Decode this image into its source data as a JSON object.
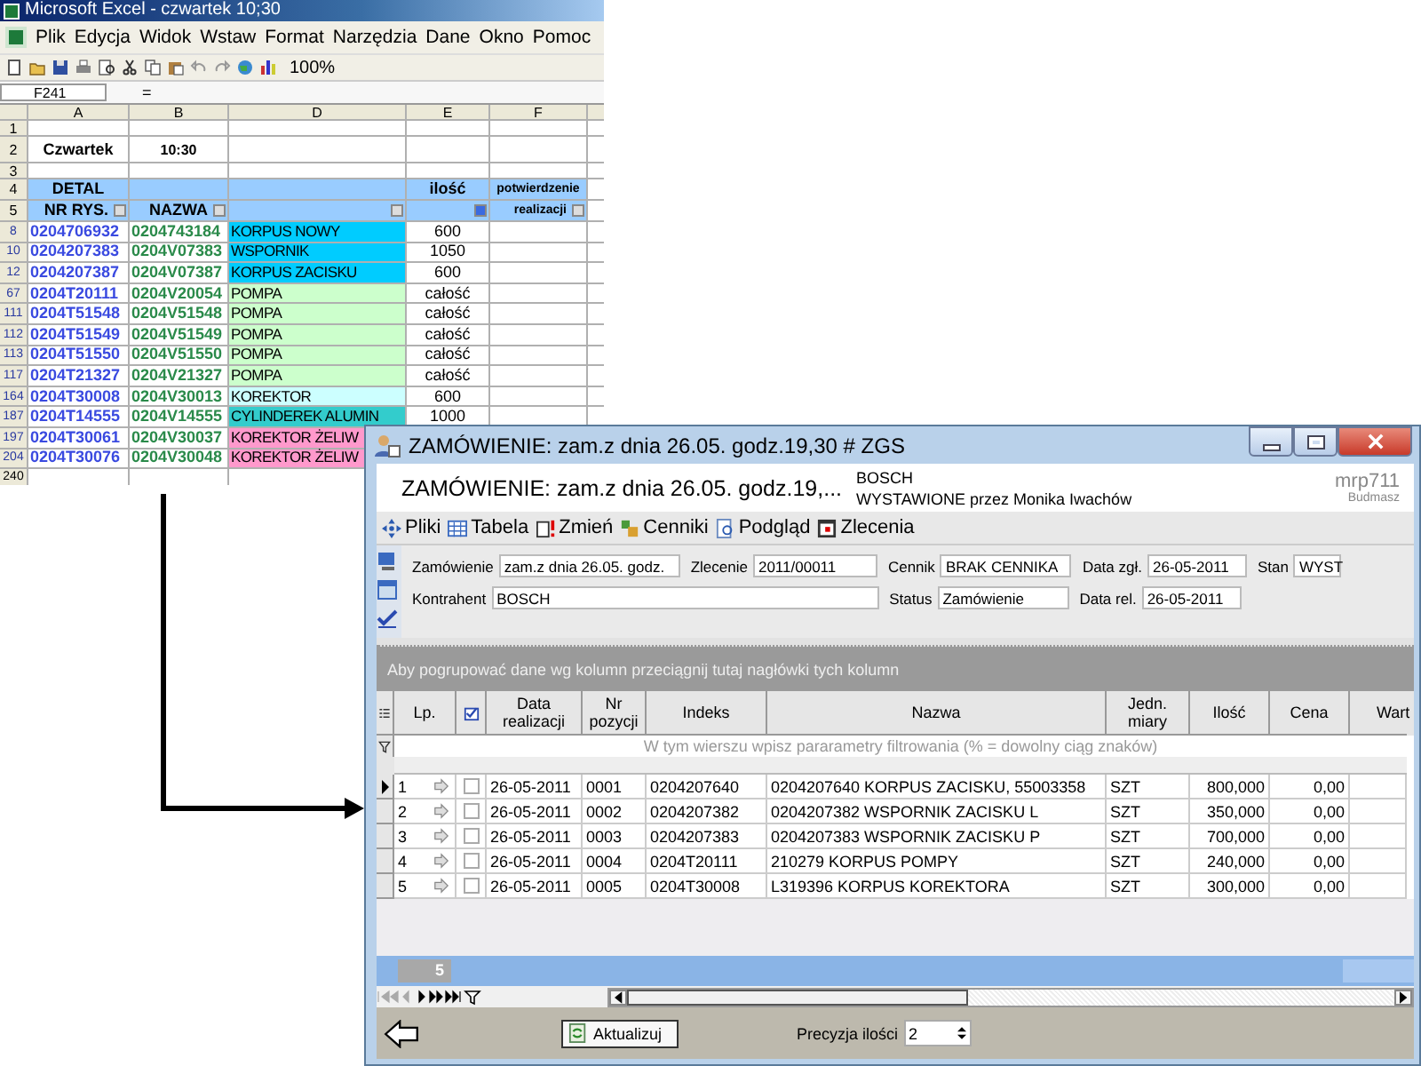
{
  "excel": {
    "title": "Microsoft Excel - czwartek 10;30",
    "menu": [
      "Plik",
      "Edycja",
      "Widok",
      "Wstaw",
      "Format",
      "Narzędzia",
      "Dane",
      "Okno",
      "Pomoc"
    ],
    "zoom": "100%",
    "name_box": "F241",
    "formula_sign": "=",
    "columns": [
      "A",
      "B",
      "D",
      "E",
      "F"
    ],
    "top_rows": [
      "1",
      "2",
      "3",
      "4",
      "5"
    ],
    "day": "Czwartek",
    "time": "10:30",
    "header": {
      "detal": "DETAL",
      "nr_rys": "NR RYS.",
      "nazwa": "NAZWA",
      "ilosc": "ilość",
      "confirm_1": "potwierdzenie",
      "confirm_2": "realizacji"
    },
    "rows": [
      {
        "num": "8",
        "nr_rys": "0204706932",
        "nazwa": "0204743184",
        "opis": "KORPUS NOWY",
        "color": "#00ccff",
        "ilosc": "600"
      },
      {
        "num": "10",
        "nr_rys": "0204207383",
        "nazwa": "0204V07383",
        "opis": "WSPORNIK",
        "color": "#00ccff",
        "ilosc": "1050"
      },
      {
        "num": "12",
        "nr_rys": "0204207387",
        "nazwa": "0204V07387",
        "opis": "KORPUS ZACISKU",
        "color": "#00ccff",
        "ilosc": "600"
      },
      {
        "num": "67",
        "nr_rys": "0204T20111",
        "nazwa": "0204V20054",
        "opis": "POMPA",
        "color": "#ccffcc",
        "ilosc": "całość"
      },
      {
        "num": "111",
        "nr_rys": "0204T51548",
        "nazwa": "0204V51548",
        "opis": "POMPA",
        "color": "#ccffcc",
        "ilosc": "całość"
      },
      {
        "num": "112",
        "nr_rys": "0204T51549",
        "nazwa": "0204V51549",
        "opis": "POMPA",
        "color": "#ccffcc",
        "ilosc": "całość"
      },
      {
        "num": "113",
        "nr_rys": "0204T51550",
        "nazwa": "0204V51550",
        "opis": "POMPA",
        "color": "#ccffcc",
        "ilosc": "całość"
      },
      {
        "num": "117",
        "nr_rys": "0204T21327",
        "nazwa": "0204V21327",
        "opis": "POMPA",
        "color": "#ccffcc",
        "ilosc": "całość"
      },
      {
        "num": "164",
        "nr_rys": "0204T30008",
        "nazwa": "0204V30013",
        "opis": "KOREKTOR",
        "color": "#ccffff",
        "ilosc": "600"
      },
      {
        "num": "187",
        "nr_rys": "0204T14555",
        "nazwa": "0204V14555",
        "opis": "CYLINDEREK ALUMIN",
        "color": "#33cccc",
        "ilosc": "1000"
      },
      {
        "num": "197",
        "nr_rys": "0204T30061",
        "nazwa": "0204V30037",
        "opis": "KOREKTOR ŻELIW",
        "color": "#ff99cc"
      },
      {
        "num": "204",
        "nr_rys": "0204T30076",
        "nazwa": "0204V30048",
        "opis": "KOREKTOR ŻELIW",
        "color": "#ff99cc"
      }
    ],
    "last_row": "240"
  },
  "dialog": {
    "title": "ZAMÓWIENIE: zam.z dnia 26.05. godz.19,30 # ZGS",
    "heading": "ZAMÓWIENIE: zam.z dnia 26.05. godz.19,...",
    "client": "BOSCH",
    "issued": "WYSTAWIONE przez Monika Iwachów",
    "app": "mrp711",
    "company": "Budmasz",
    "toolbar": [
      "Pliki",
      "Tabela",
      "Zmień",
      "Cenniki",
      "Podgląd",
      "Zlecenia"
    ],
    "field_rows": [
      [
        {
          "label": "Zamówienie",
          "value": "zam.z dnia 26.05. godz."
        },
        {
          "label": "Zlecenie",
          "value": "2011/00011"
        },
        {
          "label": "Cennik",
          "value": "BRAK CENNIKA"
        },
        {
          "label": "Data zgł.",
          "value": "26-05-2011"
        },
        {
          "label": "Stan",
          "value": "WYST"
        }
      ],
      [
        {
          "label": "Kontrahent",
          "value": "BOSCH"
        },
        {
          "label": "Status",
          "value": "Zamówienie"
        },
        {
          "label": "Data rel.",
          "value": "26-05-2011"
        }
      ]
    ],
    "group_hint": "Aby pogrupować dane wg kolumn przeciągnij tutaj nagłówki tych kolumn",
    "columns": [
      "Lp.",
      "Data realizacji",
      "Nr pozycji",
      "Indeks",
      "Nazwa",
      "Jedn. miary",
      "Ilość",
      "Cena",
      "Wart"
    ],
    "filter_hint": "W tym wierszu wpisz pararametry filtrowania (% = dowolny ciąg znaków)",
    "rows": [
      {
        "lp": "1",
        "selected": true,
        "checked": false,
        "date": "26-05-2011",
        "nr": "0001",
        "indeks": "0204207640",
        "nazwa": "0204207640 KORPUS ZACISKU, 55003358",
        "jm": "SZT",
        "ilosc": "800,000",
        "cena": "0,00"
      },
      {
        "lp": "2",
        "selected": false,
        "checked": false,
        "date": "26-05-2011",
        "nr": "0002",
        "indeks": "0204207382",
        "nazwa": "0204207382 WSPORNIK ZACISKU L",
        "jm": "SZT",
        "ilosc": "350,000",
        "cena": "0,00"
      },
      {
        "lp": "3",
        "selected": false,
        "checked": false,
        "date": "26-05-2011",
        "nr": "0003",
        "indeks": "0204207383",
        "nazwa": "0204207383 WSPORNIK ZACISKU P",
        "jm": "SZT",
        "ilosc": "700,000",
        "cena": "0,00"
      },
      {
        "lp": "4",
        "selected": false,
        "checked": false,
        "date": "26-05-2011",
        "nr": "0004",
        "indeks": "0204T20111",
        "nazwa": "210279 KORPUS POMPY",
        "jm": "SZT",
        "ilosc": "240,000",
        "cena": "0,00"
      },
      {
        "lp": "5",
        "selected": false,
        "checked": false,
        "date": "26-05-2011",
        "nr": "0005",
        "indeks": "0204T30008",
        "nazwa": "L319396 KORPUS KOREKTORA",
        "jm": "SZT",
        "ilosc": "300,000",
        "cena": "0,00"
      }
    ],
    "count": "5",
    "button": "Aktualizuj",
    "precision_label": "Precyzja ilości",
    "precision_value": "2"
  }
}
